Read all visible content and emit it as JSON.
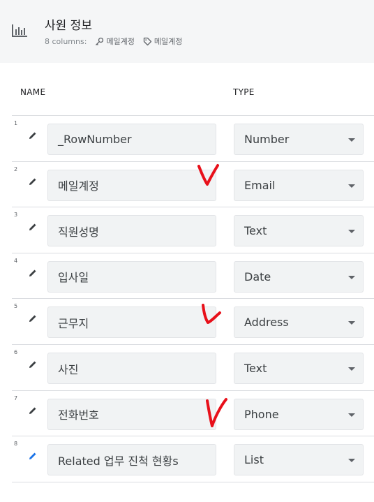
{
  "header": {
    "title": "사원 정보",
    "columns_label": "8 columns:",
    "key_chip": "메일계정",
    "label_chip": "메일계정"
  },
  "columns": {
    "name": "NAME",
    "type": "TYPE"
  },
  "rows": [
    {
      "num": "1",
      "name": "_RowNumber",
      "type": "Number"
    },
    {
      "num": "2",
      "name": "메일계정",
      "type": "Email"
    },
    {
      "num": "3",
      "name": "직원성명",
      "type": "Text"
    },
    {
      "num": "4",
      "name": "입사일",
      "type": "Date"
    },
    {
      "num": "5",
      "name": "근무지",
      "type": "Address"
    },
    {
      "num": "6",
      "name": "사진",
      "type": "Text"
    },
    {
      "num": "7",
      "name": "전화번호",
      "type": "Phone"
    },
    {
      "num": "8",
      "name": "Related 업무 진척 현황s",
      "type": "List"
    }
  ],
  "colors": {
    "edit_icon_default": "#3c4043",
    "edit_icon_active": "#1a73e8",
    "annotation_red": "#e8101a"
  },
  "icons": {
    "table": "bar-chart-table-icon",
    "key": "key-icon",
    "label": "tag-icon",
    "edit": "pencil-icon",
    "dropdown": "caret-down-icon"
  }
}
